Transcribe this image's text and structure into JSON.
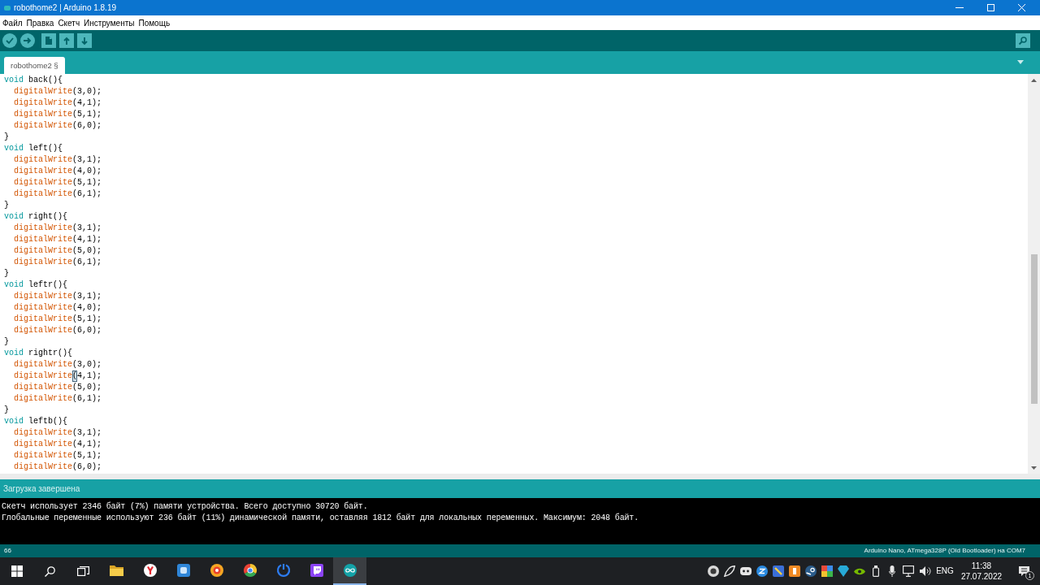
{
  "window": {
    "title": "robothome2 | Arduino 1.8.19"
  },
  "menu": [
    "Файл",
    "Правка",
    "Скетч",
    "Инструменты",
    "Помощь"
  ],
  "tabs": [
    {
      "label": "robothome2 §",
      "selected": true
    }
  ],
  "sketch": {
    "functions": [
      {
        "keyword": "void",
        "name": "back",
        "opening": "(){",
        "closing": "}",
        "body": [
          {
            "call": "digitalWrite",
            "args": "(3,0);",
            "bracket_highlight": false
          },
          {
            "call": "digitalWrite",
            "args": "(4,1);",
            "bracket_highlight": false
          },
          {
            "call": "digitalWrite",
            "args": "(5,1);",
            "bracket_highlight": false
          },
          {
            "call": "digitalWrite",
            "args": "(6,0);",
            "bracket_highlight": false
          }
        ]
      },
      {
        "keyword": "void",
        "name": "left",
        "opening": "(){",
        "closing": "}",
        "body": [
          {
            "call": "digitalWrite",
            "args": "(3,1);",
            "bracket_highlight": false
          },
          {
            "call": "digitalWrite",
            "args": "(4,0);",
            "bracket_highlight": false
          },
          {
            "call": "digitalWrite",
            "args": "(5,1);",
            "bracket_highlight": false
          },
          {
            "call": "digitalWrite",
            "args": "(6,1);",
            "bracket_highlight": false
          }
        ]
      },
      {
        "keyword": "void",
        "name": "right",
        "opening": "(){",
        "closing": "}",
        "body": [
          {
            "call": "digitalWrite",
            "args": "(3,1);",
            "bracket_highlight": false
          },
          {
            "call": "digitalWrite",
            "args": "(4,1);",
            "bracket_highlight": false
          },
          {
            "call": "digitalWrite",
            "args": "(5,0);",
            "bracket_highlight": false
          },
          {
            "call": "digitalWrite",
            "args": "(6,1);",
            "bracket_highlight": false
          }
        ]
      },
      {
        "keyword": "void",
        "name": "leftr",
        "opening": "(){",
        "closing": "}",
        "body": [
          {
            "call": "digitalWrite",
            "args": "(3,1);",
            "bracket_highlight": false
          },
          {
            "call": "digitalWrite",
            "args": "(4,0);",
            "bracket_highlight": false
          },
          {
            "call": "digitalWrite",
            "args": "(5,1);",
            "bracket_highlight": false
          },
          {
            "call": "digitalWrite",
            "args": "(6,0);",
            "bracket_highlight": false
          }
        ]
      },
      {
        "keyword": "void",
        "name": "rightr",
        "opening": "(){",
        "closing": "}",
        "body": [
          {
            "call": "digitalWrite",
            "args": "(3,0);",
            "bracket_highlight": false
          },
          {
            "call": "digitalWrite",
            "args": "(4,1);",
            "bracket_highlight": true
          },
          {
            "call": "digitalWrite",
            "args": "(5,0);",
            "bracket_highlight": false
          },
          {
            "call": "digitalWrite",
            "args": "(6,1);",
            "bracket_highlight": false
          }
        ]
      },
      {
        "keyword": "void",
        "name": "leftb",
        "opening": "(){",
        "body": [
          {
            "call": "digitalWrite",
            "args": "(3,1);",
            "bracket_highlight": false
          },
          {
            "call": "digitalWrite",
            "args": "(4,1);",
            "bracket_highlight": false
          },
          {
            "call": "digitalWrite",
            "args": "(5,1);",
            "bracket_highlight": false
          },
          {
            "call": "digitalWrite",
            "args": "(6,0);",
            "bracket_highlight": false
          }
        ]
      }
    ]
  },
  "status_message": "Загрузка завершена",
  "console_lines": [
    "Скетч использует 2346 байт (7%) памяти устройства. Всего доступно 30720 байт.",
    "Глобальные переменные используют 236 байт (11%) динамической памяти, оставляя 1812 байт для локальных переменных. Максимум: 2048 байт."
  ],
  "status_bar": {
    "line": "66",
    "board": "Arduino Nano, ATmega328P (Old Bootloader) на COM7"
  },
  "taskbar": {
    "apps": [
      {
        "kind": "folder",
        "selected": false
      },
      {
        "kind": "y-shape",
        "selected": false
      },
      {
        "kind": "tile",
        "selected": false
      },
      {
        "kind": "ring",
        "selected": false
      },
      {
        "kind": "wheel",
        "selected": false
      },
      {
        "kind": "arc",
        "selected": false
      },
      {
        "kind": "chat-tile",
        "selected": false
      },
      {
        "kind": "infinity",
        "selected": true
      }
    ],
    "language": "ENG",
    "time": "11:38",
    "date": "27.07.2022",
    "notification_count": "1"
  }
}
